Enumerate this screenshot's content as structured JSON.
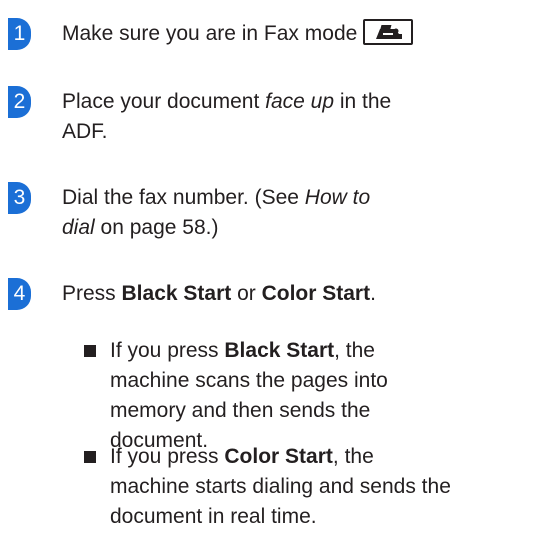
{
  "steps": [
    {
      "number": "1",
      "line1": "Make sure you are in Fax mode",
      "key_icon": "fax-mode-icon"
    },
    {
      "number": "2",
      "line1_pre": "Place your document ",
      "line1_em": "face up",
      "line1_post": " in the",
      "line2": "ADF."
    },
    {
      "number": "3",
      "line1_pre": "Dial the fax number. (See ",
      "line1_em": "How to",
      "line2_em": "dial",
      "line2_post": " on page 58.)"
    },
    {
      "number": "4",
      "pre": "Press ",
      "b1": "Black Start",
      "mid": " or ",
      "b2": "Color Start",
      "post": "."
    }
  ],
  "bullets": [
    {
      "pre": "If you press ",
      "bold": "Black Start",
      "post": ", the",
      "lines": [
        "machine scans the pages into",
        "memory and then sends the",
        "document."
      ]
    },
    {
      "pre": "If you press ",
      "bold": "Color Start",
      "post": ", the",
      "lines": [
        "machine starts dialing and sends the",
        "document in real time."
      ]
    }
  ],
  "colors": {
    "badge": "#1b6fd6",
    "text": "#231f20"
  }
}
